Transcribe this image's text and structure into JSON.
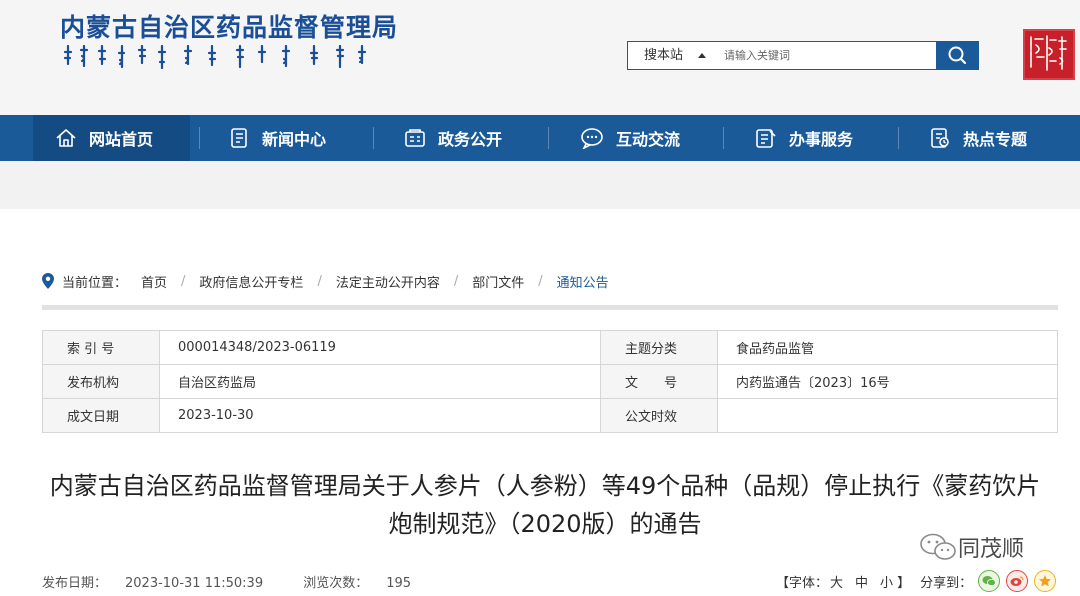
{
  "header": {
    "site_title": "内蒙古自治区药品监督管理局",
    "search_scope": "搜本站",
    "search_placeholder": "请输入关键词"
  },
  "nav": [
    {
      "label": "网站首页",
      "icon": "home-icon",
      "active": true
    },
    {
      "label": "新闻中心",
      "icon": "news-icon"
    },
    {
      "label": "政务公开",
      "icon": "government-icon"
    },
    {
      "label": "互动交流",
      "icon": "chat-icon"
    },
    {
      "label": "办事服务",
      "icon": "service-icon"
    },
    {
      "label": "热点专题",
      "icon": "topic-icon"
    }
  ],
  "breadcrumb": {
    "label": "当前位置：",
    "items": [
      "首页",
      "政府信息公开专栏",
      "法定主动公开内容",
      "部门文件",
      "通知公告"
    ]
  },
  "meta": {
    "rows": [
      {
        "k1": "索 引 号",
        "v1": "000014348/2023-06119",
        "k2": "主题分类",
        "v2": "食品药品监管"
      },
      {
        "k1": "发布机构",
        "v1": "自治区药监局",
        "k2": "文　　号",
        "v2": "内药监通告〔2023〕16号"
      },
      {
        "k1": "成文日期",
        "v1": "2023-10-30",
        "k2": "公文时效",
        "v2": ""
      }
    ]
  },
  "article": {
    "title_line1": "内蒙古自治区药品监督管理局关于人参片（人参粉）等49个品种（品规）停止执行《蒙药饮片",
    "title_line2": "炮制规范》（2020版）的通告",
    "publish_label": "发布日期：",
    "publish_date": "2023-10-31 11:50:39",
    "views_label": "浏览次数：",
    "views": "195"
  },
  "tools": {
    "font_label": "【字体：",
    "size_large": "大",
    "size_medium": "中",
    "size_small": "小",
    "font_close": "】",
    "share_label": "分享到："
  },
  "watermark": "同茂顺",
  "colors": {
    "primary": "#1a5a98",
    "seal": "#c8202a",
    "link": "#1a5a98"
  }
}
